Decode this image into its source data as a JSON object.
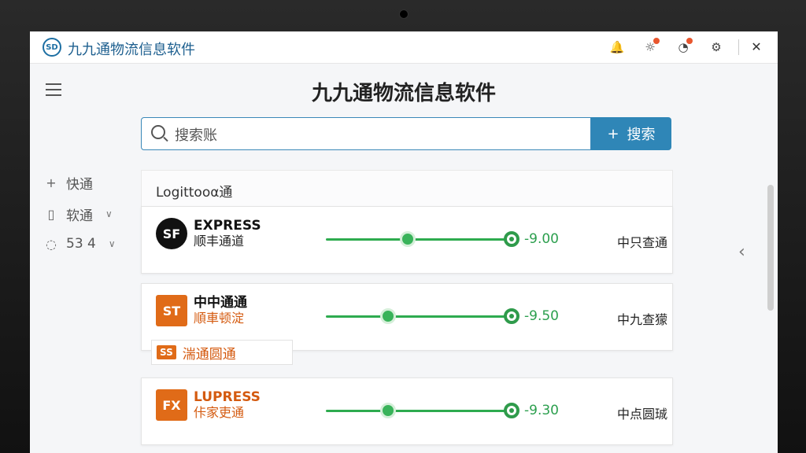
{
  "window": {
    "app_title": "九九通物流信息软件",
    "logo_text": "SD"
  },
  "page": {
    "title": "九九通物流信息软件"
  },
  "search": {
    "value": "搜索账",
    "button_label": "搜索"
  },
  "sidebar": {
    "items": [
      {
        "label": "快通",
        "icon": "plus-icon",
        "dropdown": false
      },
      {
        "label": "软通",
        "icon": "document-icon",
        "dropdown": true
      },
      {
        "label": "53 4",
        "icon": "chat-icon",
        "dropdown": true
      }
    ]
  },
  "list_header": "Logittooα通",
  "carriers": [
    {
      "badge": "SF",
      "name_top": "EXPRESS",
      "name_bottom": "顺丰通道",
      "progress": 0.45,
      "rate": "-9.00",
      "status": "中只查通"
    },
    {
      "badge": "ST",
      "name_top": "中中通通",
      "name_bottom": "順車顿淀",
      "progress": 0.34,
      "rate": "-9.50",
      "status": "中九查獴",
      "tag_badge": "SS",
      "tag_text": "湍通圆通"
    },
    {
      "badge": "FX",
      "name_top": "LUPRESS",
      "name_bottom": "佧家吏通",
      "progress": 0.34,
      "rate": "-9.30",
      "status": "中点圆珹"
    }
  ],
  "colors": {
    "accent": "#2f86b7",
    "progress": "#2eab4f",
    "brand_orange": "#e06b18",
    "notification": "#e8562e"
  }
}
